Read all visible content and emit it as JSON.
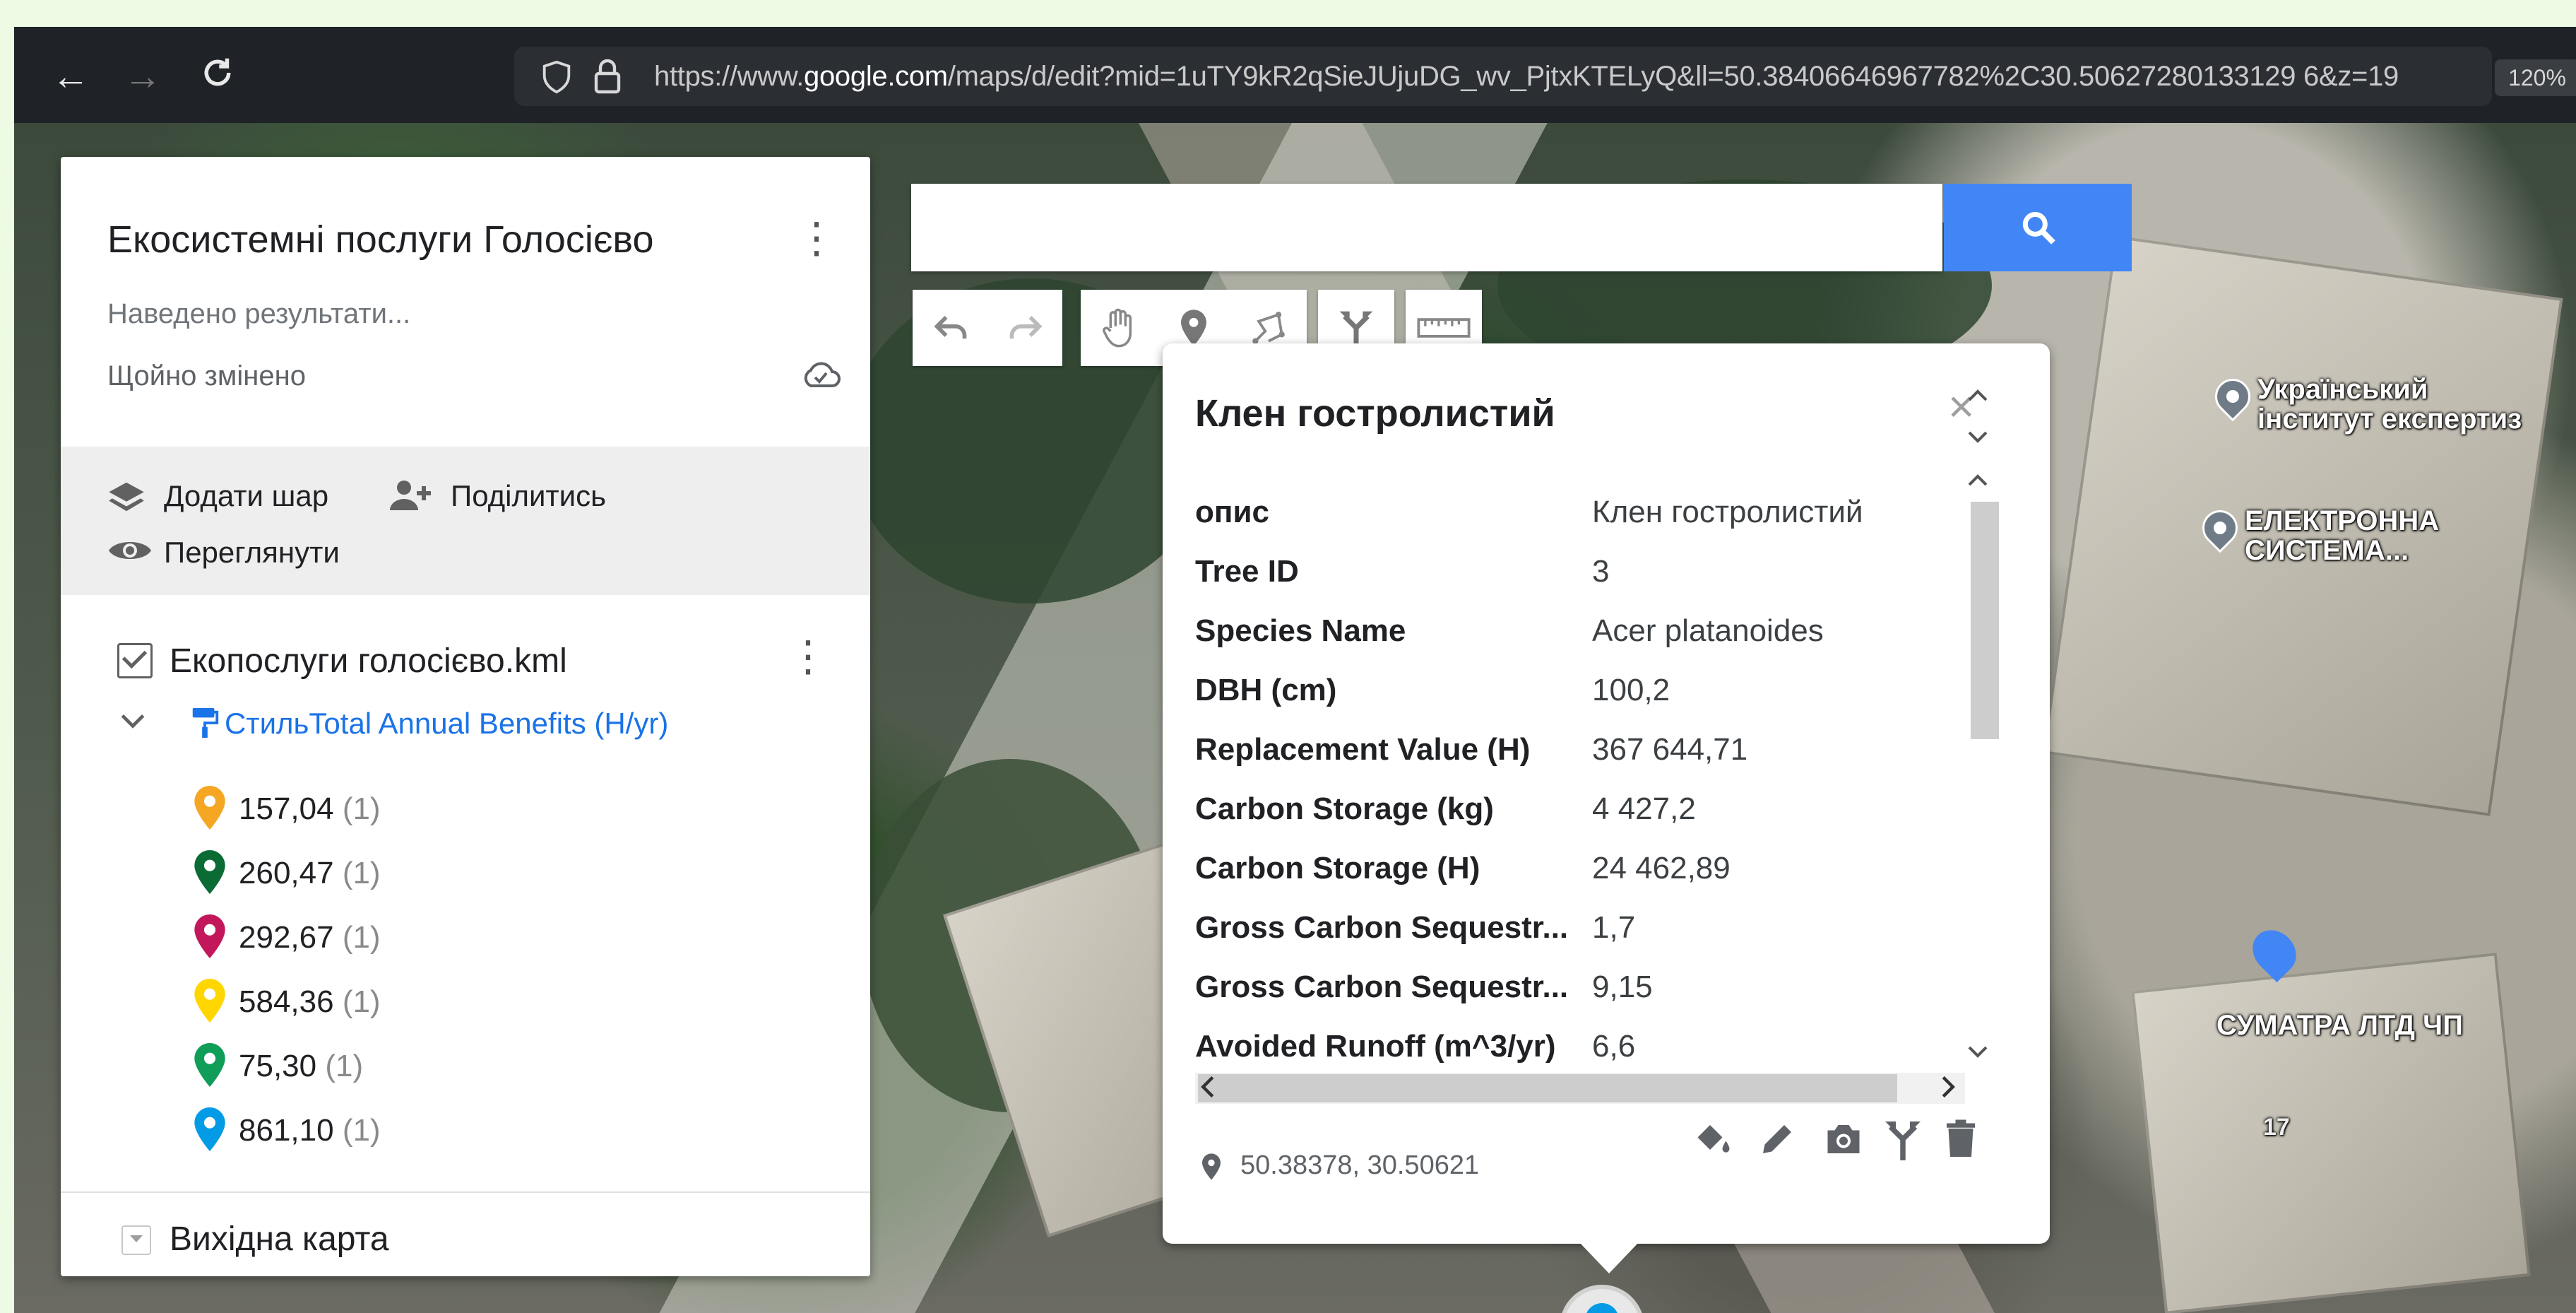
{
  "browser": {
    "back_icon": "arrow-left-icon",
    "forward_icon": "arrow-right-icon",
    "reload_icon": "reload-icon",
    "url_prefix": "https://www.",
    "url_host": "google.com",
    "url_path": "/maps/d/edit?mid=1uTY9kR2qSieJUjuDG_wv_PjtxKTELyQ&ll=50.38406646967782%2C30.50627280133129 6&z=19",
    "zoom": "120%"
  },
  "panel": {
    "title": "Екосистемні послуги Голосієво",
    "description": "Наведено результати...",
    "status": "Щойно змінено",
    "actions": {
      "add_layer": "Додати шар",
      "share": "Поділитись",
      "preview": "Переглянути"
    },
    "layer": {
      "name": "Екопослуги голосієво.kml",
      "style_label": "СтильTotal Annual Benefits (H/yr)",
      "legend": [
        {
          "value": "157,04",
          "count": "(1)",
          "color": "#f5a623"
        },
        {
          "value": "260,47",
          "count": "(1)",
          "color": "#0b6b35"
        },
        {
          "value": "292,67",
          "count": "(1)",
          "color": "#c2185b"
        },
        {
          "value": "584,36",
          "count": "(1)",
          "color": "#ffd600"
        },
        {
          "value": "75,30",
          "count": "(1)",
          "color": "#0f9d58"
        },
        {
          "value": "861,10",
          "count": "(1)",
          "color": "#039be5"
        }
      ]
    },
    "base_map": "Вихідна карта"
  },
  "search": {
    "placeholder": ""
  },
  "map_labels": {
    "poi_1_line1": "Український",
    "poi_1_line2": "інститут експертиз",
    "poi_2_line1": "ЕЛЕКТРОННА",
    "poi_2_line2": "СИСТЕМА...",
    "poi_3": "СУМАТРА ЛТД ЧП",
    "building_number": "17"
  },
  "info_window": {
    "title": "Клен гостролистий",
    "rows": [
      {
        "key": "опис",
        "value": "Клен гостролистий"
      },
      {
        "key": "Tree ID",
        "value": "3"
      },
      {
        "key": "Species Name",
        "value": "Acer platanoides"
      },
      {
        "key": "DBH (cm)",
        "value": "100,2"
      },
      {
        "key": "Replacement Value (H)",
        "value": "367 644,71"
      },
      {
        "key": "Carbon Storage (kg)",
        "value": "4 427,2"
      },
      {
        "key": "Carbon Storage (H)",
        "value": "24 462,89"
      },
      {
        "key": "Gross Carbon Sequestr...",
        "value": "1,7"
      },
      {
        "key": "Gross Carbon Sequestr...",
        "value": "9,15"
      },
      {
        "key": "Avoided Runoff (m^3/yr)",
        "value": "6,6"
      }
    ],
    "coordinates": "50.38378, 30.50621"
  },
  "colors": {
    "accent": "#1a73e8",
    "search_button": "#4285f4"
  }
}
